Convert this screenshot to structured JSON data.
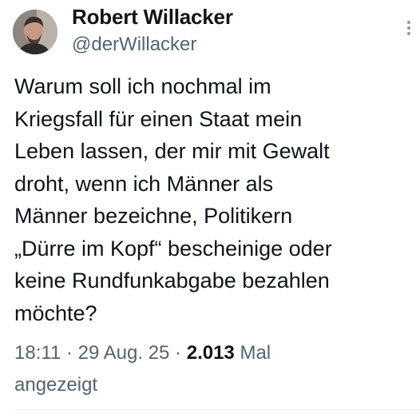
{
  "author": {
    "display_name": "Robert Willacker",
    "handle": "@derWillacker"
  },
  "tweet": {
    "text": "Warum soll ich nochmal im\nKriegsfall für einen Staat mein\nLeben lassen, der mir mit Gewalt\ndroht, wenn ich Männer als\nMänner bezeichne, Politikern\n„Dürre im Kopf“ bescheinige oder\nkeine Rundfunkabgabe bezahlen\nmöchte?",
    "time": "18:11",
    "separator": " · ",
    "date": "29 Aug. 25",
    "views_count": "2.013",
    "views_label_1": "Mal",
    "views_label_2": "angezeigt"
  },
  "icons": {
    "avatar": "profile-photo",
    "more": "more-vertical-icon"
  },
  "colors": {
    "text": "#0f1419",
    "secondary": "#536471",
    "background": "#ffffff"
  }
}
